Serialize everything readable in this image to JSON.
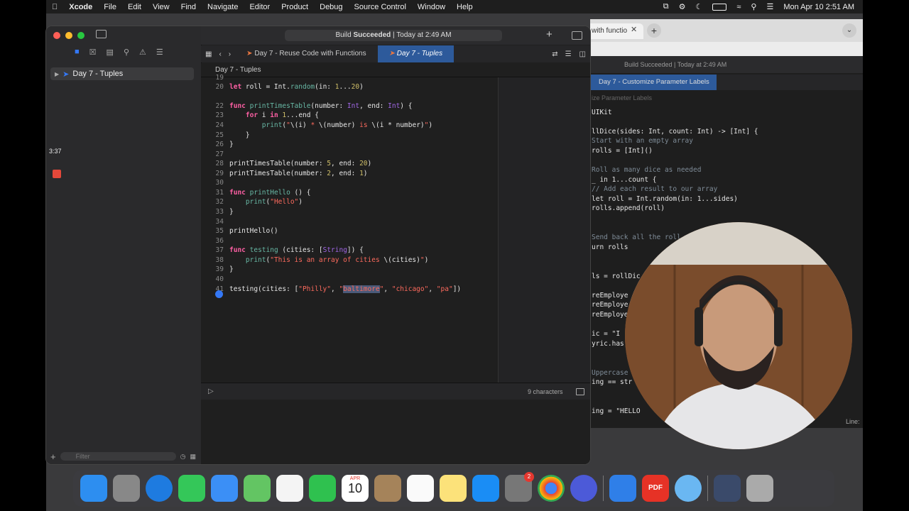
{
  "menubar": {
    "app": "Xcode",
    "items": [
      "File",
      "Edit",
      "View",
      "Find",
      "Navigate",
      "Editor",
      "Product",
      "Debug",
      "Source Control",
      "Window",
      "Help"
    ],
    "clock": "Mon Apr 10  2:51 AM"
  },
  "xcode": {
    "status_prefix": "Build ",
    "status_bold": "Succeeded",
    "status_suffix": " | Today at 2:49 AM",
    "tabs": [
      "Day 7 - Reuse Code with Functions",
      "Day 7 - Tuples"
    ],
    "jump_bar": "Day 7 - Tuples",
    "navigator_item": "Day 7 - Tuples",
    "filter_placeholder": "Filter",
    "debug_status": "9 characters",
    "first_line_no": "19"
  },
  "overlay": {
    "timer": "3:37"
  },
  "background_window": {
    "tab_label": "with functio",
    "status": "Build Succeeded | Today at 2:49 AM",
    "active_tab": "Day 7 - Customize Parameter Labels",
    "jump": "ize Parameter Labels",
    "code_lines": [
      "UIKit",
      "",
      "llDice(sides: Int, count: Int) -> [Int] {",
      "Start with an empty array",
      "rolls = [Int]()",
      "",
      "Roll as many dice as needed",
      "_ in 1...count {",
      "// Add each result to our array",
      "let roll = Int.random(in: 1...sides)",
      "rolls.append(roll)",
      "",
      "",
      "Send back all the roll",
      "urn rolls",
      "",
      "",
      "ls = rollDic",
      "",
      "reEmploye",
      "reEmploye",
      "reEmploye",
      "",
      "ic = \"I",
      "yric.has",
      "",
      "",
      "Uppercase",
      "ing == str",
      "",
      "",
      "ing = \"HELLO"
    ],
    "line_label": "Line:"
  },
  "dock": {
    "calendar_month": "APR",
    "calendar_day": "10",
    "settings_badge": "2",
    "pdf_label": "PDF"
  },
  "colors": {
    "keyword": "#fc5fa3",
    "string": "#fc6a5d",
    "number": "#d0bf69",
    "accent": "#2d5a9b"
  }
}
